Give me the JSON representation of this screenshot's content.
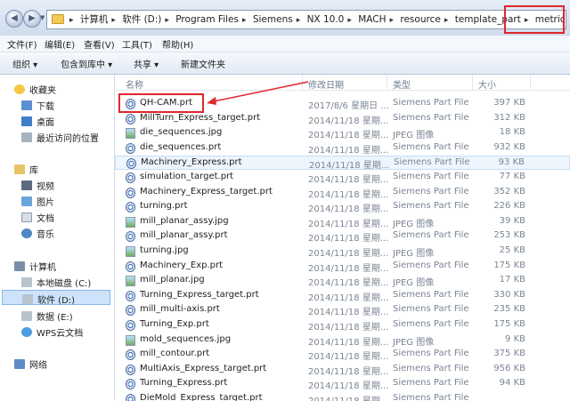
{
  "address": {
    "crumbs": [
      "计算机",
      "软件 (D:)",
      "Program Files",
      "Siemens",
      "NX 10.0",
      "MACH",
      "resource",
      "template_part",
      "metric"
    ]
  },
  "menu": [
    "文件(F)",
    "编辑(E)",
    "查看(V)",
    "工具(T)",
    "帮助(H)"
  ],
  "toolbar": {
    "organize": "组织 ▾",
    "include": "包含到库中 ▾",
    "share": "共享 ▾",
    "new_folder": "新建文件夹"
  },
  "sidebar": {
    "favorites": "收藏夹",
    "downloads": "下载",
    "desktop": "桌面",
    "recent": "最近访问的位置",
    "libraries": "库",
    "videos": "视频",
    "pictures": "图片",
    "documents": "文档",
    "music": "音乐",
    "computer": "计算机",
    "drive_c": "本地磁盘 (C:)",
    "drive_d": "软件 (D:)",
    "drive_e": "数据 (E:)",
    "wps": "WPS云文档",
    "network": "网络"
  },
  "columns": {
    "name": "名称",
    "date": "修改日期",
    "type": "类型",
    "size": "大小"
  },
  "files": [
    {
      "name": "QH-CAM.prt",
      "date": "2017/8/6 星期日 ...",
      "type": "Siemens Part File",
      "size": "397 KB",
      "icon": "prt"
    },
    {
      "name": "MillTurn_Express_target.prt",
      "date": "2014/11/18 星期...",
      "type": "Siemens Part File",
      "size": "312 KB",
      "icon": "prt"
    },
    {
      "name": "die_sequences.jpg",
      "date": "2014/11/18 星期...",
      "type": "JPEG 图像",
      "size": "18 KB",
      "icon": "jpg"
    },
    {
      "name": "die_sequences.prt",
      "date": "2014/11/18 星期...",
      "type": "Siemens Part File",
      "size": "932 KB",
      "icon": "prt"
    },
    {
      "name": "Machinery_Express.prt",
      "date": "2014/11/18 星期...",
      "type": "Siemens Part File",
      "size": "93 KB",
      "icon": "prt"
    },
    {
      "name": "simulation_target.prt",
      "date": "2014/11/18 星期...",
      "type": "Siemens Part File",
      "size": "77 KB",
      "icon": "prt"
    },
    {
      "name": "Machinery_Express_target.prt",
      "date": "2014/11/18 星期...",
      "type": "Siemens Part File",
      "size": "352 KB",
      "icon": "prt"
    },
    {
      "name": "turning.prt",
      "date": "2014/11/18 星期...",
      "type": "Siemens Part File",
      "size": "226 KB",
      "icon": "prt"
    },
    {
      "name": "mill_planar_assy.jpg",
      "date": "2014/11/18 星期...",
      "type": "JPEG 图像",
      "size": "39 KB",
      "icon": "jpg"
    },
    {
      "name": "mill_planar_assy.prt",
      "date": "2014/11/18 星期...",
      "type": "Siemens Part File",
      "size": "253 KB",
      "icon": "prt"
    },
    {
      "name": "turning.jpg",
      "date": "2014/11/18 星期...",
      "type": "JPEG 图像",
      "size": "25 KB",
      "icon": "jpg"
    },
    {
      "name": "Machinery_Exp.prt",
      "date": "2014/11/18 星期...",
      "type": "Siemens Part File",
      "size": "175 KB",
      "icon": "prt"
    },
    {
      "name": "mill_planar.jpg",
      "date": "2014/11/18 星期...",
      "type": "JPEG 图像",
      "size": "17 KB",
      "icon": "jpg"
    },
    {
      "name": "Turning_Express_target.prt",
      "date": "2014/11/18 星期...",
      "type": "Siemens Part File",
      "size": "330 KB",
      "icon": "prt"
    },
    {
      "name": "mill_multi-axis.prt",
      "date": "2014/11/18 星期...",
      "type": "Siemens Part File",
      "size": "235 KB",
      "icon": "prt"
    },
    {
      "name": "Turning_Exp.prt",
      "date": "2014/11/18 星期...",
      "type": "Siemens Part File",
      "size": "175 KB",
      "icon": "prt"
    },
    {
      "name": "mold_sequences.jpg",
      "date": "2014/11/18 星期...",
      "type": "JPEG 图像",
      "size": "9 KB",
      "icon": "jpg"
    },
    {
      "name": "mill_contour.prt",
      "date": "2014/11/18 星期...",
      "type": "Siemens Part File",
      "size": "375 KB",
      "icon": "prt"
    },
    {
      "name": "MultiAxis_Express_target.prt",
      "date": "2014/11/18 星期...",
      "type": "Siemens Part File",
      "size": "956 KB",
      "icon": "prt"
    },
    {
      "name": "Turning_Express.prt",
      "date": "2014/11/18 星期...",
      "type": "Siemens Part File",
      "size": "94 KB",
      "icon": "prt"
    },
    {
      "name": "DieMold_Express_target.prt",
      "date": "2014/11/18 星期...",
      "type": "Siemens Part File",
      "size": "",
      "icon": "prt"
    }
  ],
  "colors": {
    "highlight": "#e0262d",
    "selection": "#cde3fb"
  }
}
